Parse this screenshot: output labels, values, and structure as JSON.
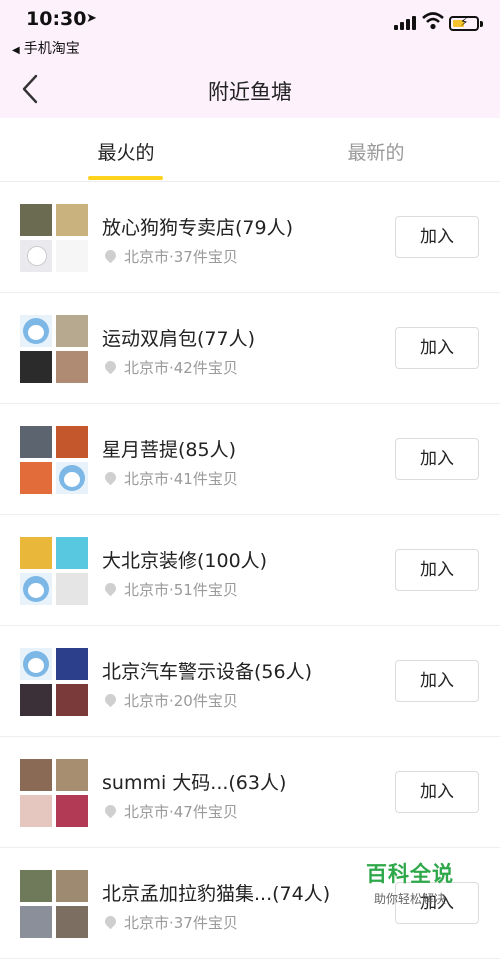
{
  "status_bar": {
    "time": "10:30",
    "back_app": "手机淘宝",
    "battery_color": "#f4c32e"
  },
  "nav": {
    "title": "附近鱼塘"
  },
  "tabs": {
    "hot": "最火的",
    "newest": "最新的",
    "active": "hot",
    "accent": "#ffd21e"
  },
  "ponds": [
    {
      "name": "放心狗狗专卖店(79人)",
      "meta": "北京市·37件宝贝",
      "join": "加入",
      "thumbs": [
        [
          "#6b6b52",
          "photo"
        ],
        [
          "#c9b27e",
          "photo"
        ],
        [
          "#e9e9ee",
          "ghost"
        ],
        [
          "#f6f6f6",
          "photo"
        ]
      ]
    },
    {
      "name": "运动双肩包(77人)",
      "meta": "北京市·42件宝贝",
      "join": "加入",
      "thumbs": [
        [
          "#e8f2fb",
          "penguin"
        ],
        [
          "#b7a98f",
          "photo"
        ],
        [
          "#2b2b2b",
          "photo"
        ],
        [
          "#b08b74",
          "photo"
        ]
      ]
    },
    {
      "name": "星月菩提(85人)",
      "meta": "北京市·41件宝贝",
      "join": "加入",
      "thumbs": [
        [
          "#5c6470",
          "photo"
        ],
        [
          "#c4572b",
          "photo"
        ],
        [
          "#e26c3a",
          "photo"
        ],
        [
          "#e8f2fb",
          "penguin"
        ]
      ]
    },
    {
      "name": "大北京装修(100人)",
      "meta": "北京市·51件宝贝",
      "join": "加入",
      "thumbs": [
        [
          "#e9b739",
          "photo"
        ],
        [
          "#58c7e0",
          "photo"
        ],
        [
          "#e8f2fb",
          "penguin"
        ],
        [
          "#e5e5e5",
          "photo"
        ]
      ]
    },
    {
      "name": "北京汽车警示设备(56人)",
      "meta": "北京市·20件宝贝",
      "join": "加入",
      "thumbs": [
        [
          "#e8f2fb",
          "penguin"
        ],
        [
          "#2c3f8a",
          "photo"
        ],
        [
          "#3c3038",
          "photo"
        ],
        [
          "#7a3a3a",
          "photo"
        ]
      ]
    },
    {
      "name": "summi 大码...(63人)",
      "meta": "北京市·47件宝贝",
      "join": "加入",
      "thumbs": [
        [
          "#8a6a55",
          "photo"
        ],
        [
          "#a78e70",
          "photo"
        ],
        [
          "#e6c7c0",
          "photo"
        ],
        [
          "#b23a55",
          "photo"
        ]
      ]
    },
    {
      "name": "北京孟加拉豹猫集...(74人)",
      "meta": "北京市·37件宝贝",
      "join": "加入",
      "thumbs": [
        [
          "#6e7a5a",
          "photo"
        ],
        [
          "#9d8a70",
          "photo"
        ],
        [
          "#8a8f99",
          "photo"
        ],
        [
          "#7d6e62",
          "photo"
        ]
      ]
    }
  ],
  "watermark": {
    "title": "百科全说",
    "subtitle": "助你轻松解决"
  }
}
